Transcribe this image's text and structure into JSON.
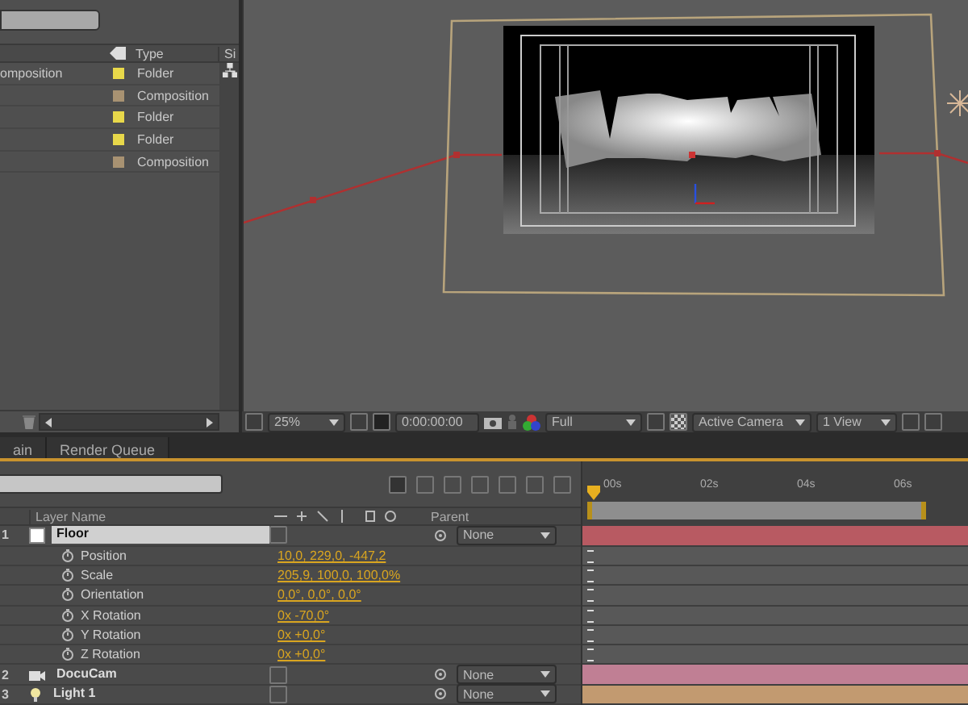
{
  "project": {
    "columns": [
      "Type",
      "Si"
    ],
    "items": [
      {
        "name": "omposition",
        "color": "#e8d84a",
        "type": "Folder"
      },
      {
        "color": "#a89272",
        "type": "Composition"
      },
      {
        "color": "#e8d84a",
        "type": "Folder"
      },
      {
        "color": "#e8d84a",
        "type": "Folder"
      },
      {
        "color": "#a89272",
        "type": "Composition"
      }
    ]
  },
  "viewer": {
    "zoom": "25%",
    "time": "0:00:00:00",
    "resolution": "Full",
    "view": "Active Camera",
    "layout": "1 View"
  },
  "tabs": [
    {
      "label": "ain"
    },
    {
      "label": "Render Queue"
    }
  ],
  "timeline": {
    "columns": [
      "Layer Name",
      "Parent"
    ],
    "ruler": [
      "00s",
      "02s",
      "04s",
      "06s"
    ],
    "layers": [
      {
        "number": "1",
        "name": "Floor",
        "kind": "solid",
        "parent": "None",
        "color": "#b85a62",
        "properties": [
          {
            "name": "Position",
            "value": "10,0, 229,0, -447,2"
          },
          {
            "name": "Scale",
            "value": "205,9, 100,0, 100,0%"
          },
          {
            "name": "Orientation",
            "value": "0,0°, 0,0°, 0,0°"
          },
          {
            "name": "X Rotation",
            "value": "0x -70,0°"
          },
          {
            "name": "Y Rotation",
            "value": "0x +0,0°"
          },
          {
            "name": "Z Rotation",
            "value": "0x +0,0°"
          }
        ]
      },
      {
        "number": "2",
        "name": "DocuCam",
        "kind": "camera",
        "parent": "None",
        "color": "#c07f94"
      },
      {
        "number": "3",
        "name": "Light 1",
        "kind": "light",
        "parent": "None",
        "color": "#c29a70"
      }
    ]
  }
}
